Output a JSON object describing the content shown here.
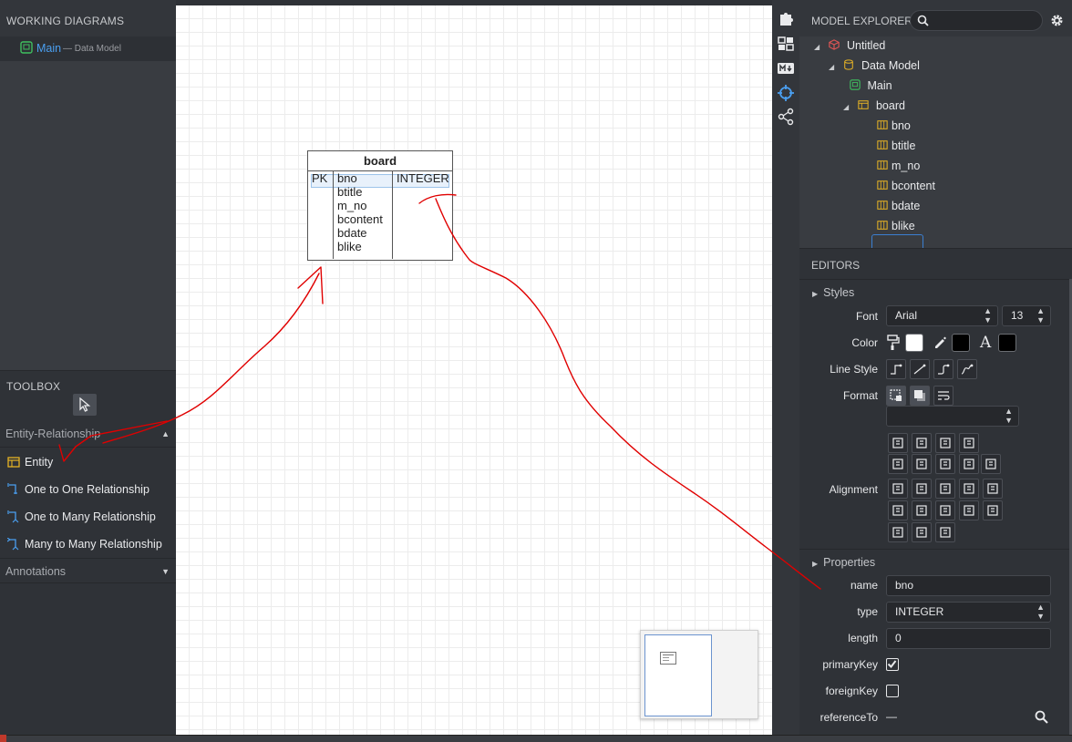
{
  "working_diagrams": {
    "title": "WORKING DIAGRAMS",
    "item_name": "Main",
    "item_sub": "— Data Model"
  },
  "toolbox": {
    "title": "TOOLBOX",
    "group_er": "Entity-Relationship",
    "items": [
      "Entity",
      "One to One Relationship",
      "One to Many Relationship",
      "Many to Many Relationship"
    ],
    "group_annotations": "Annotations"
  },
  "entity": {
    "name": "board",
    "pk_label": "PK",
    "columns": [
      "bno",
      "btitle",
      "m_no",
      "bcontent",
      "bdate",
      "blike"
    ],
    "first_type": "INTEGER"
  },
  "model_explorer": {
    "title": "MODEL EXPLORER",
    "search_value": "",
    "tree": {
      "root": "Untitled",
      "data_model": "Data Model",
      "diagram": "Main",
      "table": "board",
      "columns": [
        "bno",
        "btitle",
        "m_no",
        "bcontent",
        "bdate",
        "blike"
      ]
    }
  },
  "editors": {
    "title": "EDITORS",
    "styles_title": "Styles",
    "font_label": "Font",
    "font_value": "Arial",
    "font_size": "13",
    "color_label": "Color",
    "color_fill": "#ffffff",
    "color_line": "#000000",
    "color_font": "#000000",
    "line_style_label": "Line Style",
    "format_label": "Format",
    "format_select_value": "",
    "alignment_label": "Alignment"
  },
  "properties": {
    "title": "Properties",
    "name_label": "name",
    "name_value": "bno",
    "type_label": "type",
    "type_value": "INTEGER",
    "length_label": "length",
    "length_value": "0",
    "primary_key_label": "primaryKey",
    "primary_key_checked": true,
    "foreign_key_label": "foreignKey",
    "foreign_key_checked": false,
    "reference_label": "referenceTo",
    "reference_value": "—"
  },
  "colors": {
    "accent": "#3b7fd1",
    "annotation": "#e00000"
  }
}
